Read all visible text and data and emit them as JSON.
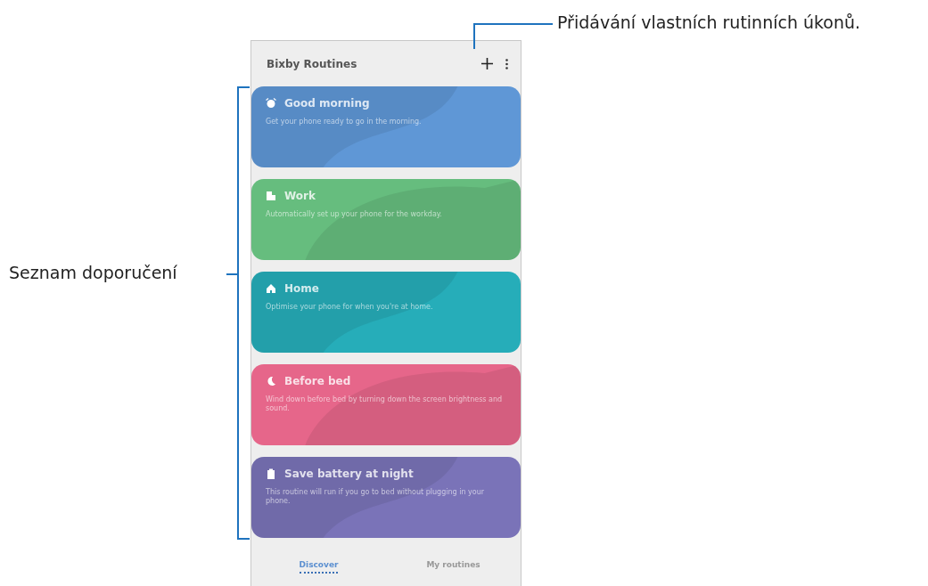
{
  "callouts": {
    "add": "Přidávání vlastních rutinních úkonů.",
    "list": "Seznam doporučení"
  },
  "app": {
    "title": "Bixby Routines",
    "cards": [
      {
        "title": "Good morning",
        "description": "Get your phone ready to go in the morning.",
        "color": "#5f97d6",
        "kind": "alarm"
      },
      {
        "title": "Work",
        "description": "Automatically set up your phone for the workday.",
        "color": "#66bd7e",
        "kind": "building"
      },
      {
        "title": "Home",
        "description": "Optimise your phone for when you're at home.",
        "color": "#26adb9",
        "kind": "home"
      },
      {
        "title": "Before bed",
        "description": "Wind down before bed by turning down the screen brightness and sound.",
        "color": "#e6668a",
        "kind": "moon"
      },
      {
        "title": "Save battery at night",
        "description": "This routine will run if you go to bed without plugging in your phone.",
        "color": "#7a73b8",
        "kind": "battery"
      }
    ],
    "tabs": [
      {
        "label": "Discover",
        "selected": true
      },
      {
        "label": "My routines",
        "selected": false
      }
    ]
  }
}
